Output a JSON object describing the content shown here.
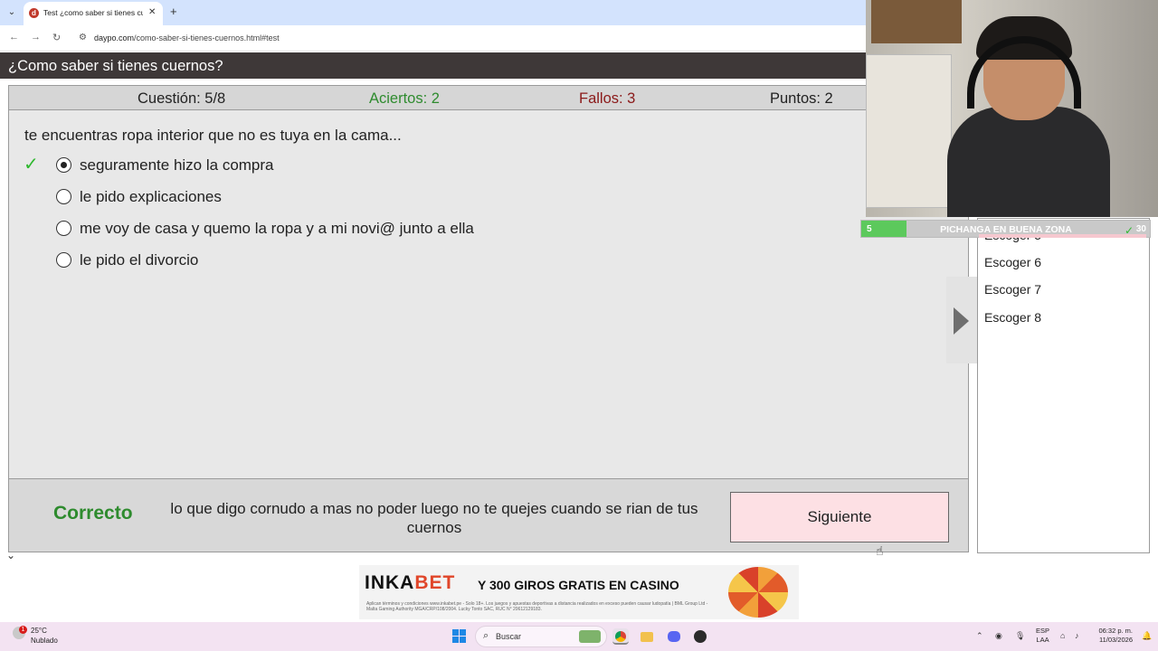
{
  "browser": {
    "tab_title": "Test ¿como saber si tienes cue",
    "tab_close": "✕",
    "new_tab": "+",
    "url_host": "daypo.com",
    "url_path": "/como-saber-si-tienes-cuernos.html#test"
  },
  "page": {
    "title": "¿Como saber si tienes cuernos?"
  },
  "stats": {
    "question": "Cuestión: 5/8",
    "correct": "Aciertos: 2",
    "wrong": "Fallos: 3",
    "points": "Puntos: 2"
  },
  "quiz": {
    "question": "te encuentras ropa interior que no es tuya en la cama...",
    "options": [
      {
        "label": "seguramente hizo la compra",
        "selected": true,
        "correct": true
      },
      {
        "label": "le pido explicaciones",
        "selected": false
      },
      {
        "label": "me voy de casa y quemo la ropa y a mi novi@ junto a ella",
        "selected": false
      },
      {
        "label": "le pido el divorcio",
        "selected": false
      }
    ],
    "check_mark": "✓"
  },
  "feedback": {
    "result": "Correcto",
    "explanation": "lo que digo cornudo a mas no poder luego no te quejes cuando se rian de tus cuernos",
    "next_label": "Siguiente"
  },
  "sidebar": {
    "items": [
      "Escoger 5",
      "Escoger 6",
      "Escoger 7",
      "Escoger 8"
    ]
  },
  "overlay": {
    "left": "5",
    "title": "PICHANGA EN BUENA ZONA",
    "right": "30",
    "progress": 0.156
  },
  "ad": {
    "brand_a": "INKA",
    "brand_b": "BET",
    "promo": "Y 300 GIROS GRATIS EN CASINO",
    "fine_print": "Aplican términos y condiciones www.inkabet.pe - Solo 18+. Los juegos y apuestas deportivas a distancia realizados en exceso pueden causar ludopatía | BML Group Ltd - Malta Gaming Authority MGA/CRP/108/2004. Lucky Tonto SAC, RUC N° 20612129183."
  },
  "taskbar": {
    "weather_badge": "1",
    "temperature": "25°C",
    "weather": "Nublado",
    "search_label": "Buscar",
    "lang_top": "ESP",
    "lang_bottom": "LAA",
    "time": "06:32 p. m.",
    "date": "11/03/2026"
  },
  "colors": {
    "header_bg": "#3e3838",
    "correct_green": "#2e8b2e",
    "wrong_red": "#8b1a1a",
    "next_button_bg": "#fde0e4",
    "overlay_green": "#5cc95c"
  }
}
